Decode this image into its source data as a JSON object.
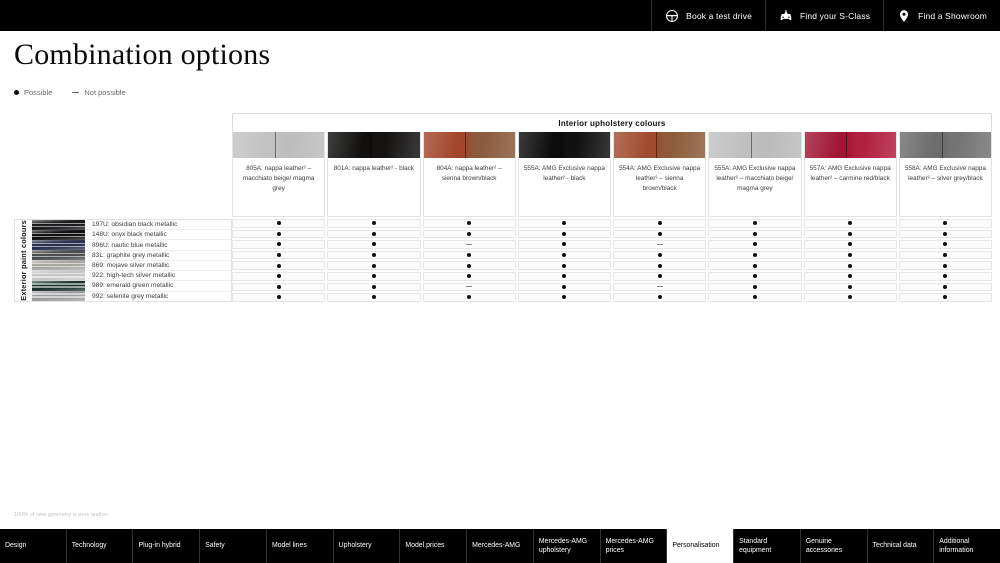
{
  "topbar": {
    "items": [
      {
        "label": "Book a test drive",
        "icon": "steering-wheel-icon"
      },
      {
        "label": "Find your S-Class",
        "icon": "car-icon"
      },
      {
        "label": "Find a Showroom",
        "icon": "map-pin-icon"
      }
    ]
  },
  "page": {
    "heading": "Combination options",
    "footnote": "100% of new geometry is pure leather"
  },
  "legend": {
    "possible": "Possible",
    "not_possible": "Not possible"
  },
  "matrix": {
    "title": "Interior upholstery colours",
    "row_axis_label": "Exterior paint colours",
    "columns": [
      {
        "label": "805A: nappa leather² – macchiato beige/ magma grey",
        "swatch_left": "#c2c2c2",
        "swatch_right": "#bdbdbd"
      },
      {
        "label": "801A: nappa leather² - black",
        "swatch_left": "#100f0e",
        "swatch_right": "#151413"
      },
      {
        "label": "804A: nappa leather² – sienna brown/black",
        "swatch_left": "#a2452b",
        "swatch_right": "#8a5a3c"
      },
      {
        "label": "555A: AMG Exclusive nappa leather² - black",
        "swatch_left": "#0d0c0c",
        "swatch_right": "#121111"
      },
      {
        "label": "554A: AMG Exclusive nappa leather² – sienna brown/black",
        "swatch_left": "#a04b2e",
        "swatch_right": "#8d5b3a"
      },
      {
        "label": "555A: AMG Exclusive nappa leather² – macchiato beige/ magma grey",
        "swatch_left": "#c0c0c0",
        "swatch_right": "#bbbbbb"
      },
      {
        "label": "557A: AMG Exclusive nappa leather² – carmine red/black",
        "swatch_left": "#a01634",
        "swatch_right": "#b11f3e"
      },
      {
        "label": "558A: AMG Exclusive nappa leather² – silver grey/black",
        "swatch_left": "#6c6c6c",
        "swatch_right": "#747474"
      }
    ],
    "rows": [
      {
        "label": "197U: obsidian black metallic",
        "paint": "#1b1b1d"
      },
      {
        "label": "148U: onyx black metallic",
        "paint": "#101012"
      },
      {
        "label": "896U: nautic blue metallic",
        "paint": "#2b3250"
      },
      {
        "label": "83L: graphite grey metallic",
        "paint": "#4a4c50"
      },
      {
        "label": "869: mojave silver metallic",
        "paint": "#a9a7a3"
      },
      {
        "label": "922: high-tech silver metallic",
        "paint": "#c5c6c8"
      },
      {
        "label": "989: emerald green metallic",
        "paint": "#17332c"
      },
      {
        "label": "992: selenite grey metallic",
        "paint": "#9b9c9e"
      }
    ],
    "availability": [
      [
        "dot",
        "dot",
        "dot",
        "dot",
        "dot",
        "dot",
        "dot",
        "dot"
      ],
      [
        "dot",
        "dot",
        "dot",
        "dot",
        "dot",
        "dot",
        "dot",
        "dot"
      ],
      [
        "dot",
        "dot",
        "dash",
        "dot",
        "dash",
        "dot",
        "dot",
        "dot"
      ],
      [
        "dot",
        "dot",
        "dot",
        "dot",
        "dot",
        "dot",
        "dot",
        "dot"
      ],
      [
        "dot",
        "dot",
        "dot",
        "dot",
        "dot",
        "dot",
        "dot",
        "dot"
      ],
      [
        "dot",
        "dot",
        "dot",
        "dot",
        "dot",
        "dot",
        "dot",
        "dot"
      ],
      [
        "dot",
        "dot",
        "dash",
        "dot",
        "dash",
        "dot",
        "dot",
        "dot"
      ],
      [
        "dot",
        "dot",
        "dot",
        "dot",
        "dot",
        "dot",
        "dot",
        "dot"
      ]
    ]
  },
  "tabs": [
    {
      "label": "Design",
      "active": false
    },
    {
      "label": "Technology",
      "active": false
    },
    {
      "label": "Plug-in hybrid",
      "active": false
    },
    {
      "label": "Safety",
      "active": false
    },
    {
      "label": "Model lines",
      "active": false
    },
    {
      "label": "Upholstery",
      "active": false
    },
    {
      "label": "Model prices",
      "active": false
    },
    {
      "label": "Mercedes-AMG",
      "active": false
    },
    {
      "label": "Mercedes-AMG upholstery",
      "active": false
    },
    {
      "label": "Mercedes-AMG prices",
      "active": false
    },
    {
      "label": "Personalisation",
      "active": true
    },
    {
      "label": "Standard equipment",
      "active": false
    },
    {
      "label": "Genuine accessories",
      "active": false
    },
    {
      "label": "Technical data",
      "active": false
    },
    {
      "label": "Additional information",
      "active": false
    }
  ]
}
